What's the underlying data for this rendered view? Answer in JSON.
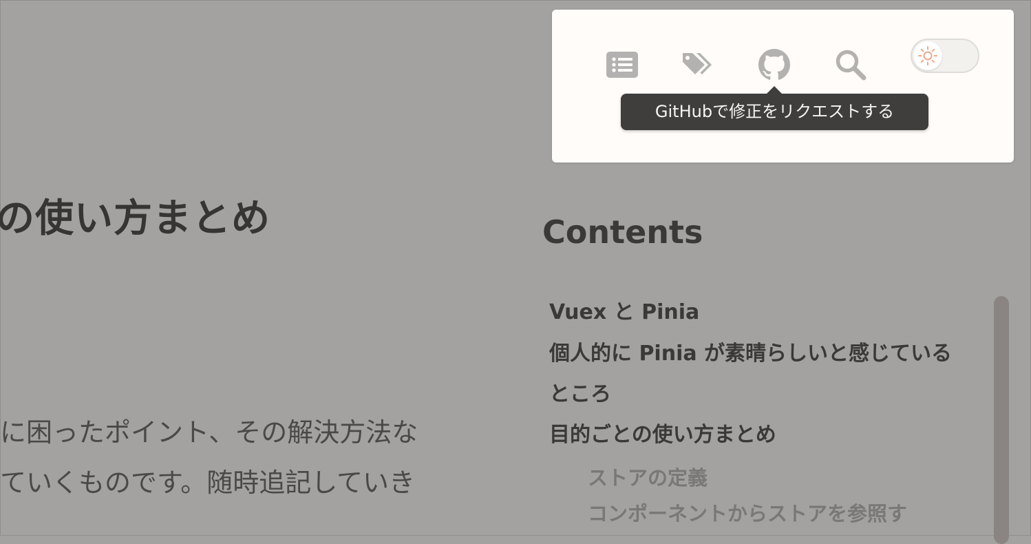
{
  "article": {
    "title": "の使い方まとめ",
    "body_lines": [
      "に困ったポイント、その解決方法な",
      "ていくものです。随時追記していき"
    ]
  },
  "toolbar": {
    "buttons": [
      {
        "name": "toc-button",
        "icon": "list-icon"
      },
      {
        "name": "tags-button",
        "icon": "tags-icon"
      },
      {
        "name": "github-button",
        "icon": "github-icon"
      },
      {
        "name": "search-button",
        "icon": "search-icon"
      }
    ],
    "theme_toggle": {
      "icon": "sun-icon",
      "state": "light"
    },
    "tooltip": "GitHubで修正をリクエストする"
  },
  "toc": {
    "heading": "Contents",
    "items": [
      {
        "label": "Vuex と Pinia"
      },
      {
        "label": "個人的に Pinia が素晴らしいと感じているところ"
      },
      {
        "label": "目的ごとの使い方まとめ"
      }
    ],
    "sub_items": [
      {
        "label": "ストアの定義"
      },
      {
        "label": "コンポーネントからストアを参照す"
      }
    ]
  },
  "colors": {
    "overlay": "#a3a2a0",
    "card": "#fffcf9",
    "icon": "#b4b2b0",
    "tooltip": "#3f3e3d",
    "sun": "#e8a98b",
    "scrollbar": "#8a8583"
  }
}
